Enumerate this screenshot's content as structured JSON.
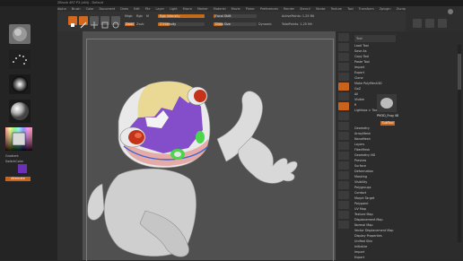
{
  "window": {
    "title": "ZBrush 4R7 P3 (x64) - Default"
  },
  "menubar": {
    "items": [
      "Alpha",
      "Brush",
      "Color",
      "Document",
      "Draw",
      "Edit",
      "File",
      "Layer",
      "Light",
      "Macro",
      "Marker",
      "Material",
      "Movie",
      "Picker",
      "Preferences",
      "Render",
      "Stencil",
      "Stroke",
      "Texture",
      "Tool",
      "Transform",
      "Zplugin",
      "Zscript"
    ],
    "right_items": [
      "Menus",
      "DefaultZScript"
    ]
  },
  "toolbar": {
    "buttons": [
      {
        "label": "Edit",
        "active": true
      },
      {
        "label": "Draw",
        "active": true
      },
      {
        "label": "Move",
        "active": false
      },
      {
        "label": "Scale",
        "active": false
      },
      {
        "label": "Rotate",
        "active": false
      }
    ],
    "mrgb_label": "Mrgb",
    "rgb_label": "Rgb",
    "m_label": "M",
    "zadd_label": "Zadd",
    "zsub_label": "Zsub",
    "rgb_intensity": {
      "label": "Rgb Intensity",
      "value": 100
    },
    "z_intensity": {
      "label": "Z Intensity",
      "value": 25
    },
    "focal_shift": {
      "label": "Focal Shift",
      "value": 0
    },
    "draw_size": {
      "label": "Draw Size",
      "value": 64
    },
    "dynamic_label": "Dynamic",
    "active_points": {
      "label": "ActivePoints:",
      "value": "1.25 Mil"
    },
    "total_points": {
      "label": "TotalPoints:",
      "value": "1.25 Mil"
    }
  },
  "left_panel": {
    "gradient_label": "Gradient",
    "switch_color_label": "SwitchColor",
    "alternate_label": "Alternate"
  },
  "right_shelf": {
    "buttons": [
      "BPR",
      "SPix 3",
      "Scroll",
      "Zoom",
      "Actual",
      "AAHalf",
      "Persp",
      "Floor",
      "Local",
      "L.Sym",
      "Xyz",
      "Frame",
      "Move",
      "Scale",
      "Rotate",
      "PolyF",
      "Transp",
      "Ghost",
      "Solo",
      "Xpose"
    ]
  },
  "tool_palette": {
    "header": "Tool",
    "top_items": [
      "Load Tool",
      "Save As",
      "Copy Tool",
      "Paste Tool",
      "Import",
      "Export",
      "Clone",
      "Make PolyMesh3D",
      "GoZ",
      "All",
      "Visible",
      "R"
    ],
    "lightbox_label": "Lightbox > Tools",
    "current_tool": "PM3D_Frog 48",
    "subtools_label": "SubTool",
    "items": [
      "Geometry",
      "ArrayMesh",
      "NanoMesh",
      "Layers",
      "FiberMesh",
      "Geometry HD",
      "Preview",
      "Surface",
      "Deformation",
      "Masking",
      "Visibility",
      "Polygroups",
      "Contact",
      "Morph Target",
      "Polypaint",
      "UV Map",
      "Texture Map",
      "Displacement Map",
      "Normal Map",
      "Vector Displacement Map",
      "Display Properties",
      "Unified Skin",
      "Initialize",
      "Import",
      "Export"
    ]
  },
  "colors": {
    "accent_orange": "#d2691e",
    "viewport_bg": "#505050",
    "mask_purple": "#7b3fc7",
    "polypaint_yellow": "#e8d48a",
    "eye_red": "#c4321a",
    "eye_green": "#4cd64c"
  }
}
